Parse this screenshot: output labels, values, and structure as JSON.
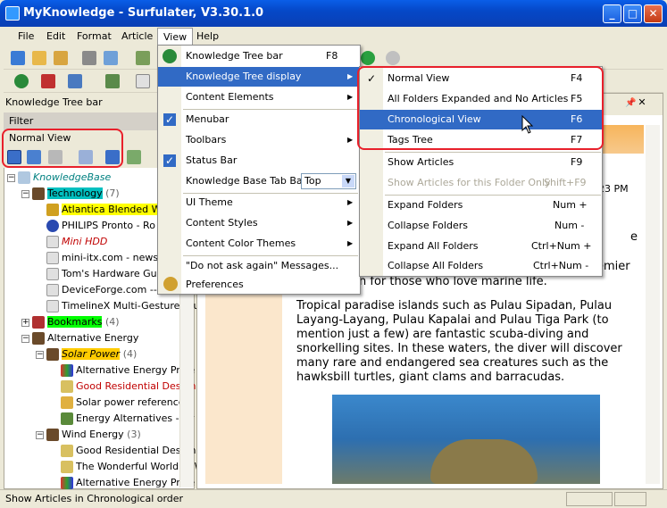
{
  "window": {
    "title": "MyKnowledge - Surfulater, V3.30.1.0"
  },
  "menubar": [
    "File",
    "Edit",
    "Format",
    "Article",
    "View",
    "Help"
  ],
  "left_panel": {
    "header": "Knowledge Tree bar",
    "filter": "Filter",
    "mode": "Normal View",
    "tree": [
      {
        "label": "KnowledgeBase",
        "color": "#008080",
        "italic": true
      },
      {
        "label": "Technology",
        "count": "(7)",
        "bg": "#00c0c0"
      },
      {
        "label": "Atlantica Blended Wir",
        "prefix": "Atlantica ",
        "bg": "#ffff00"
      },
      {
        "label": "PHILIPS Pronto - Ro"
      },
      {
        "label": "Mini HDD",
        "color": "#c00000"
      },
      {
        "label": "mini-itx.com - news"
      },
      {
        "label": "Tom's Hardware Guide"
      },
      {
        "label": "DeviceForge.com -- to"
      },
      {
        "label": "TimelineX Multi-Gesture Tou"
      },
      {
        "label": "Bookmarks",
        "count": "(4)",
        "bg": "#00ff00"
      },
      {
        "label": "Alternative Energy"
      },
      {
        "label": "Solar Power",
        "count": "(4)",
        "bg": "#ffcc00"
      },
      {
        "label": "Alternative Energy Proje"
      },
      {
        "label": "Good Residential Design",
        "color": "#c00000"
      },
      {
        "label": "Solar power reference n"
      },
      {
        "label": "Energy Alternatives - Or"
      },
      {
        "label": "Wind Energy",
        "count": "(3)"
      },
      {
        "label": "Good Residential Design"
      },
      {
        "label": "The Wonderful World of W"
      },
      {
        "label": "Alternative Energy Proje"
      }
    ]
  },
  "view_menu": {
    "items": [
      {
        "label": "Knowledge Tree bar",
        "shortcut": "F8"
      },
      {
        "label": "Knowledge Tree display",
        "submenu": true,
        "highlight": true
      },
      {
        "label": "Content Elements",
        "submenu": true
      },
      {
        "label": "Menubar",
        "checked": true
      },
      {
        "label": "Toolbars",
        "submenu": true
      },
      {
        "label": "Status Bar",
        "checked": true
      },
      {
        "label": "Knowledge Base Tab Bar",
        "value": "Top"
      },
      {
        "label": "UI Theme",
        "submenu": true
      },
      {
        "label": "Content Styles",
        "submenu": true
      },
      {
        "label": "Content Color Themes",
        "submenu": true
      },
      {
        "label": "\"Do not ask again\" Messages..."
      },
      {
        "label": "Preferences"
      }
    ]
  },
  "tree_display_menu": {
    "items": [
      {
        "label": "Normal View",
        "shortcut": "F4",
        "checked": true
      },
      {
        "label": "All Folders Expanded and No Articles",
        "shortcut": "F5"
      },
      {
        "label": "Chronological View",
        "shortcut": "F6",
        "highlight": true
      },
      {
        "label": "Tags Tree",
        "shortcut": "F7"
      },
      {
        "label": "Show Articles",
        "shortcut": "F9"
      },
      {
        "label": "Show Articles for this Folder Only",
        "shortcut": "Shift+F9",
        "disabled": true
      },
      {
        "label": "Expand Folders",
        "shortcut": "Num +"
      },
      {
        "label": "Collapse Folders",
        "shortcut": "Num -"
      },
      {
        "label": "Expand All Folders",
        "shortcut": "Ctrl+Num +"
      },
      {
        "label": "Collapse All Folders",
        "shortcut": "Ctrl+Num -"
      }
    ]
  },
  "article": {
    "time": "23 PM",
    "partial_1": "e",
    "partial_2": "emier",
    "partial_3": "n for those who love marine life.",
    "paragraph": "Tropical paradise islands such as Pulau Sipadan, Pulau Layang-Layang, Pulau Kapalai and Pulau Tiga Park (to mention just a few) are fantastic scuba-diving and snorkelling sites. In these waters, the diver will discover many rare and endangered sea creatures such as the hawksbill turtles, giant clams and barracudas."
  },
  "status": {
    "text": "Show Articles in Chronological order"
  }
}
